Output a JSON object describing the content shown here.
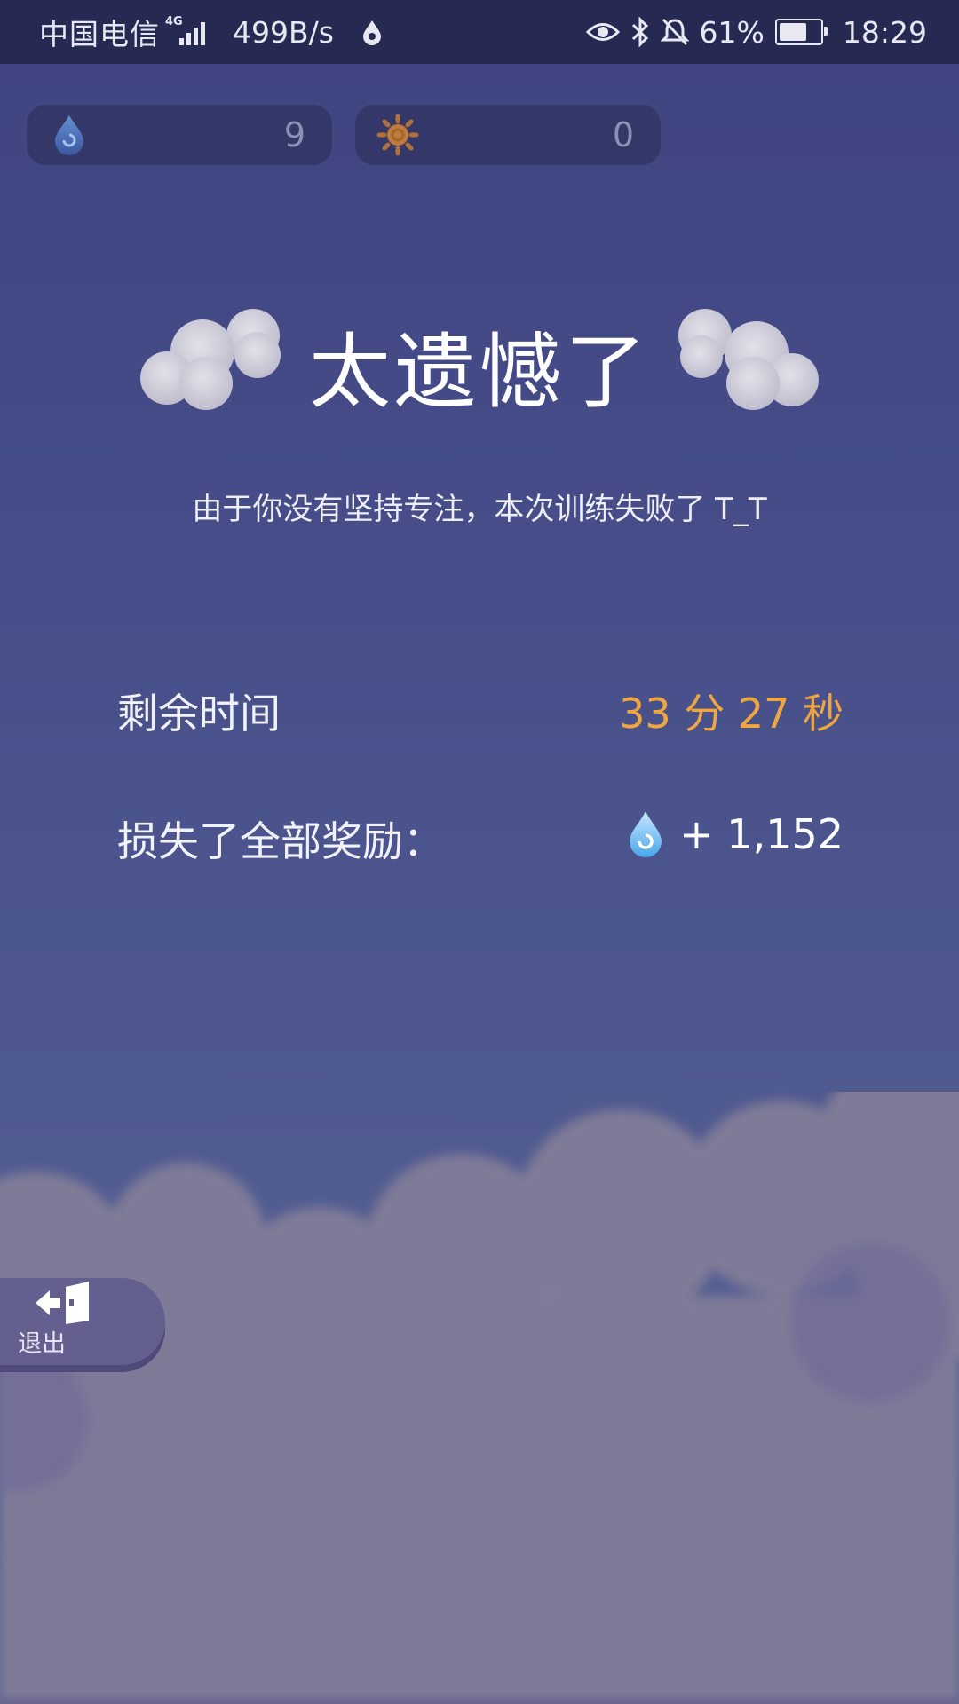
{
  "status_bar": {
    "carrier": "中国电信",
    "network_type": "4G",
    "net_speed": "499B/s",
    "battery": "61%",
    "time": "18:29"
  },
  "resources": {
    "water": {
      "icon": "water-drop-icon",
      "value": "9"
    },
    "sun": {
      "icon": "sun-icon",
      "value": "0"
    }
  },
  "result": {
    "title": "太遗憾了",
    "subtitle": "由于你没有坚持专注，本次训练失败了 T_T"
  },
  "stats": {
    "time_label": "剩余时间",
    "time_value": "33 分 27 秒",
    "lost_label": "损失了全部奖励：",
    "lost_value": "+ 1,152"
  },
  "exit_button": {
    "label": "退出",
    "icon": "exit-door-icon"
  },
  "colors": {
    "accent_orange": "#f0a640",
    "background": "#444b87",
    "status_bar": "#262a52"
  }
}
